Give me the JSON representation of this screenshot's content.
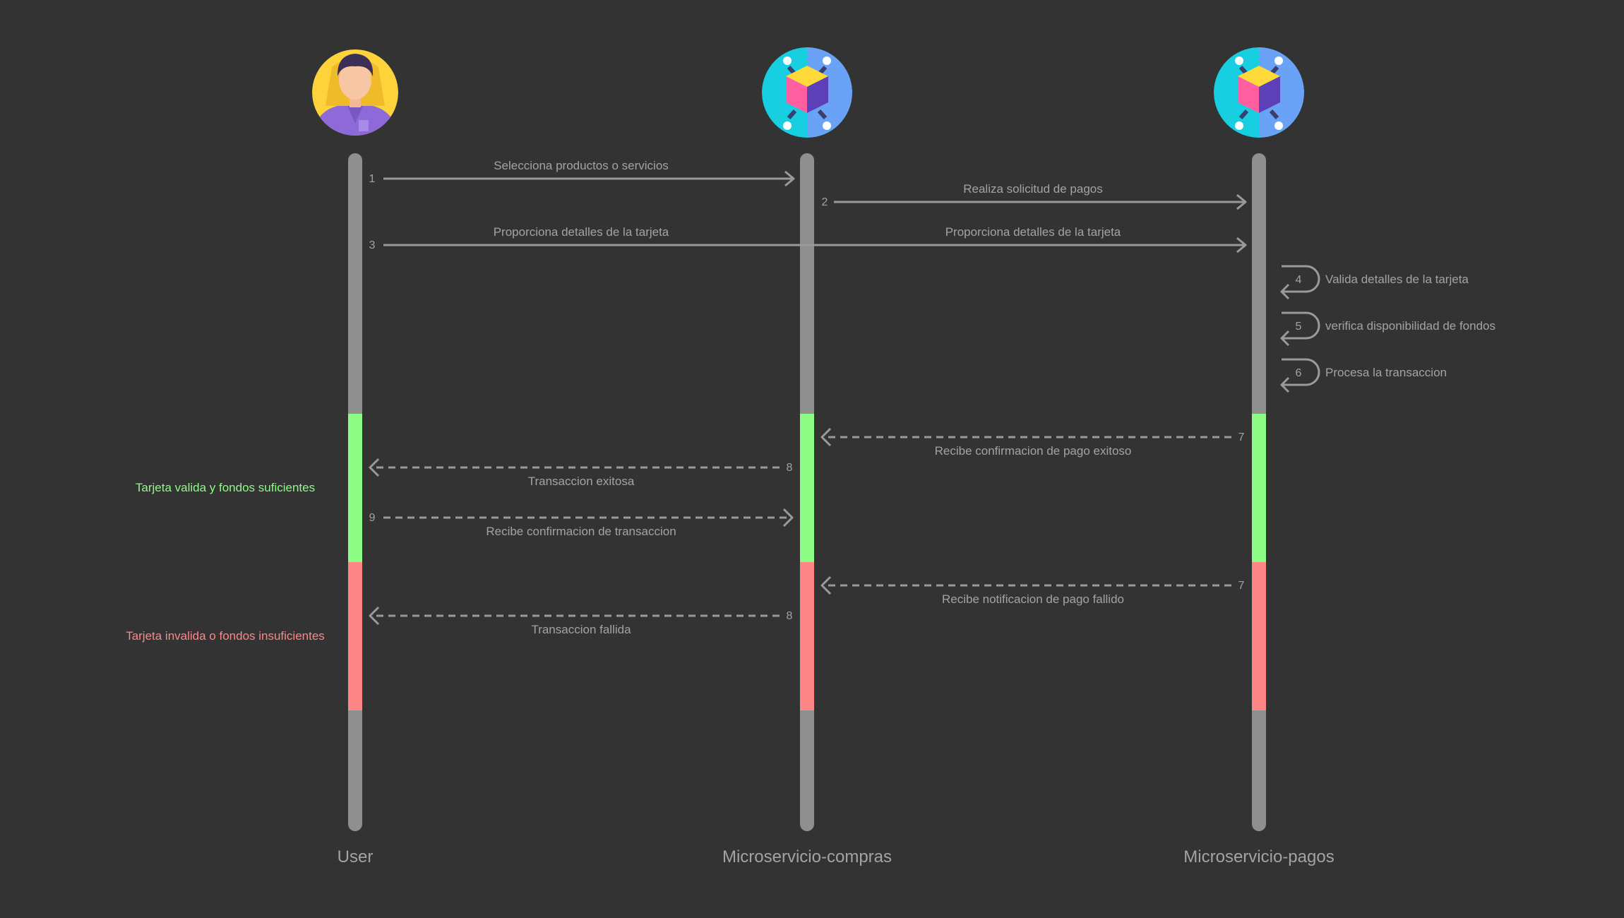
{
  "colors": {
    "background": "#333333",
    "lifeline": "#8f8f8f",
    "arrow": "#9a9a9a",
    "text": "#a3a3a3",
    "success": "#8dfc84",
    "failure": "#ff8686"
  },
  "participants": [
    {
      "id": "user",
      "label": "User",
      "icon": "user-avatar-icon"
    },
    {
      "id": "compras",
      "label": "Microservicio-compras",
      "icon": "microservice-cube-icon"
    },
    {
      "id": "pagos",
      "label": "Microservicio-pagos",
      "icon": "microservice-cube-icon"
    }
  ],
  "fragments": [
    {
      "label": "Tarjeta valida y fondos suficientes",
      "status": "success"
    },
    {
      "label": "Tarjeta invalida o fondos insuficientes",
      "status": "failure"
    }
  ],
  "messages": [
    {
      "num": "1",
      "label": "Selecciona productos o servicios",
      "from": "user",
      "to": "compras",
      "style": "solid"
    },
    {
      "num": "2",
      "label": "Realiza solicitud de pagos",
      "from": "compras",
      "to": "pagos",
      "style": "solid"
    },
    {
      "num": "3",
      "label": "Proporciona detalles de la tarjeta",
      "label2": "Proporciona detalles de la tarjeta",
      "from": "user",
      "to": "pagos",
      "style": "solid"
    },
    {
      "num": "4",
      "label": "Valida detalles de la tarjeta",
      "from": "pagos",
      "to": "pagos",
      "style": "self"
    },
    {
      "num": "5",
      "label": "verifica disponibilidad de fondos",
      "from": "pagos",
      "to": "pagos",
      "style": "self"
    },
    {
      "num": "6",
      "label": "Procesa la transaccion",
      "from": "pagos",
      "to": "pagos",
      "style": "self"
    },
    {
      "num": "7",
      "label": "Recibe confirmacion de pago exitoso",
      "from": "pagos",
      "to": "compras",
      "style": "dashed",
      "fragment": "success"
    },
    {
      "num": "8",
      "label": "Transaccion exitosa",
      "from": "compras",
      "to": "user",
      "style": "dashed",
      "fragment": "success"
    },
    {
      "num": "9",
      "label": "Recibe confirmacion de transaccion",
      "from": "user",
      "to": "compras",
      "style": "dashed",
      "fragment": "success"
    },
    {
      "num": "7",
      "label": "Recibe notificacion de pago fallido",
      "from": "pagos",
      "to": "compras",
      "style": "dashed",
      "fragment": "failure"
    },
    {
      "num": "8",
      "label": "Transaccion fallida",
      "from": "compras",
      "to": "user",
      "style": "dashed",
      "fragment": "failure"
    }
  ]
}
